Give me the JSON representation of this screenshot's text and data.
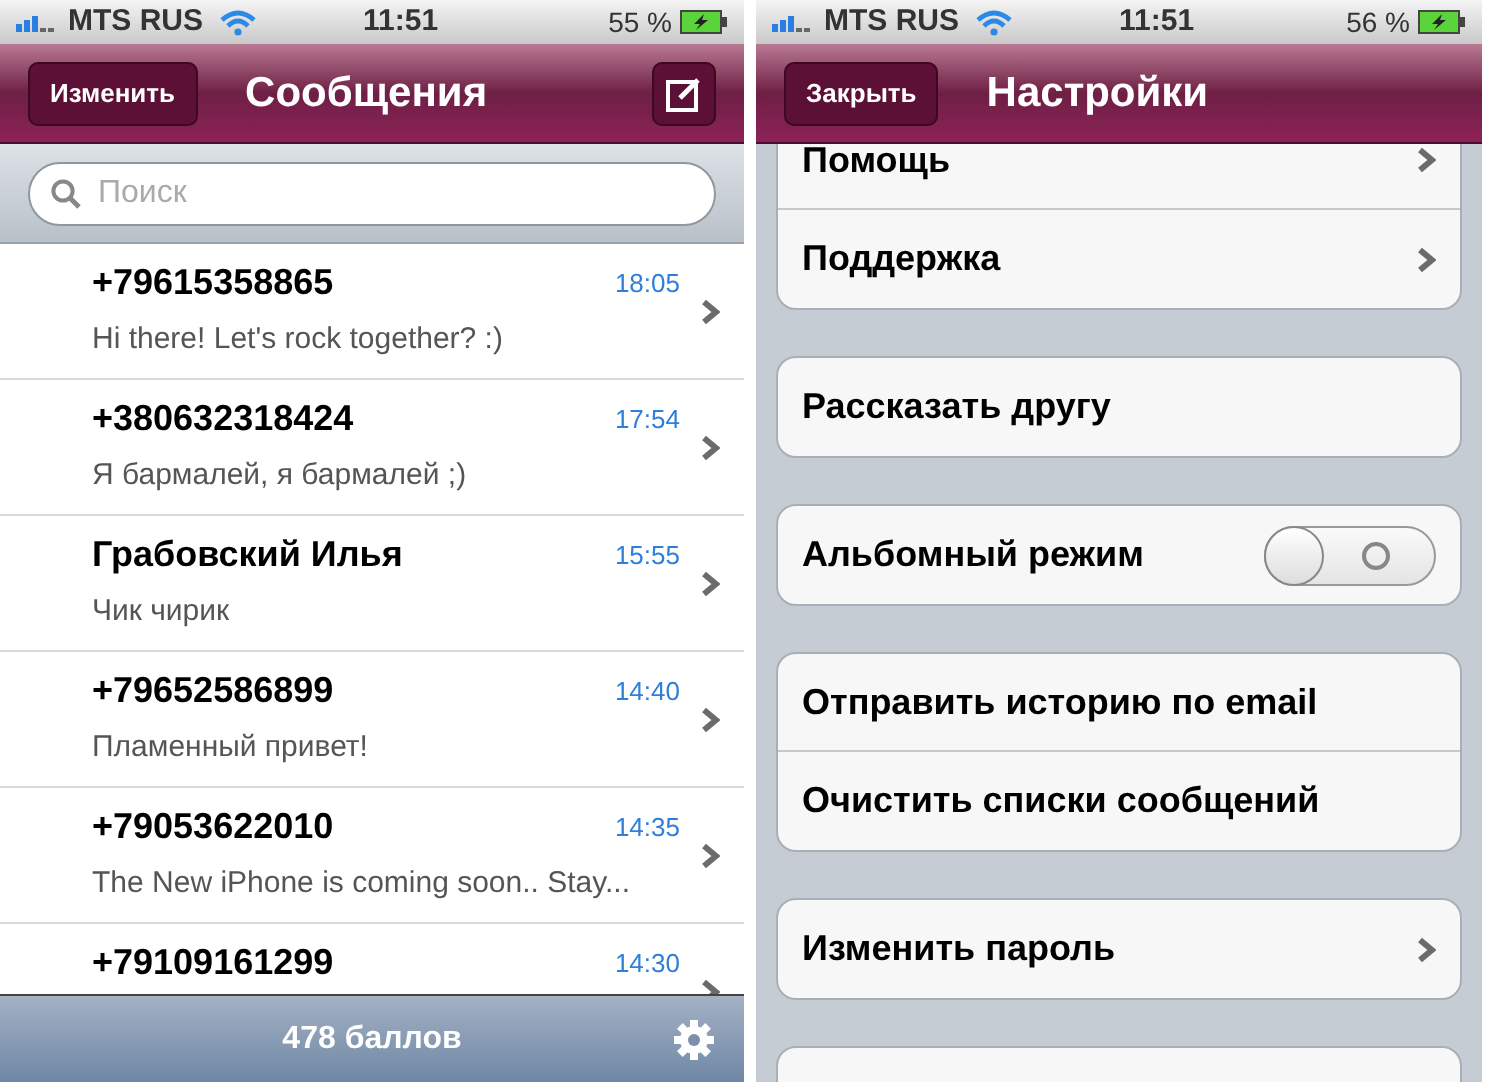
{
  "left_screen": {
    "status_bar": {
      "carrier": "MTS RUS",
      "time": "11:51",
      "battery": "55 %"
    },
    "nav_bar": {
      "left_button": "Изменить",
      "title": "Сообщения"
    },
    "search": {
      "placeholder": "Поиск"
    },
    "messages": [
      {
        "sender": "+79615358865",
        "time": "18:05",
        "preview": "Hi there! Let's rock together? :)"
      },
      {
        "sender": "+380632318424",
        "time": "17:54",
        "preview": "Я бармалей, я бармалей ;)"
      },
      {
        "sender": "Грабовский Илья",
        "time": "15:55",
        "preview": "Чик чирик"
      },
      {
        "sender": "+79652586899",
        "time": "14:40",
        "preview": "Пламенный привет!"
      },
      {
        "sender": "+79053622010",
        "time": "14:35",
        "preview": "The New iPhone is coming soon.. Stay..."
      },
      {
        "sender": "+79109161299",
        "time": "14:30"
      }
    ],
    "footer": {
      "points": "478 баллов"
    }
  },
  "right_screen": {
    "status_bar": {
      "carrier": "MTS RUS",
      "time": "11:51",
      "battery": "56 %"
    },
    "nav_bar": {
      "left_button": "Закрыть",
      "title": "Настройки"
    },
    "groups": [
      [
        {
          "kind": "link",
          "label": "Помощь"
        },
        {
          "kind": "link",
          "label": "Поддержка"
        }
      ],
      [
        {
          "kind": "action",
          "label": "Рассказать другу"
        }
      ],
      [
        {
          "kind": "toggle",
          "label": "Альбомный режим",
          "on": false
        }
      ],
      [
        {
          "kind": "action",
          "label": "Отправить историю по email"
        },
        {
          "kind": "action",
          "label": "Очистить списки сообщений"
        }
      ],
      [
        {
          "kind": "link",
          "label": "Изменить пароль"
        }
      ],
      [
        {
          "kind": "action"
        }
      ]
    ]
  }
}
